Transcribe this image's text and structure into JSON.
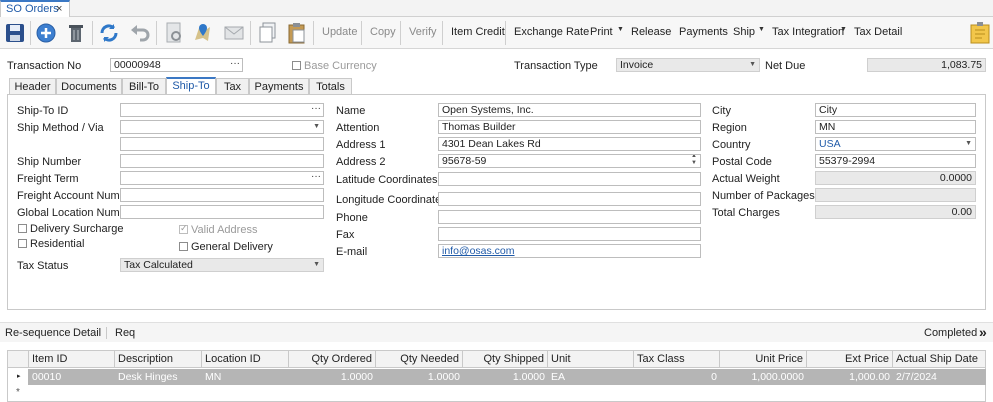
{
  "document_tab": {
    "title": "SO Orders",
    "close": "×"
  },
  "toolbar": {
    "update": "Update",
    "copy": "Copy",
    "verify": "Verify",
    "item_credit": "Item Credit",
    "exchange_rate": "Exchange Rate",
    "print": "Print",
    "release": "Release",
    "payments": "Payments",
    "ship": "Ship",
    "tax_integration": "Tax Integration",
    "tax_detail": "Tax Detail"
  },
  "header": {
    "transaction_no_label": "Transaction No",
    "transaction_no": "00000948",
    "base_currency_label": "Base Currency",
    "transaction_type_label": "Transaction Type",
    "transaction_type": "Invoice",
    "net_due_label": "Net Due",
    "net_due": "1,083.75"
  },
  "tabs": [
    "Header",
    "Documents",
    "Bill-To",
    "Ship-To",
    "Tax",
    "Payments",
    "Totals"
  ],
  "ship_to": {
    "ship_to_id_label": "Ship-To ID",
    "ship_to_id": "",
    "ship_method_label": "Ship Method / Via",
    "ship_method": "",
    "ship_number_label": "Ship Number",
    "freight_term_label": "Freight Term",
    "freight_account_label": "Freight Account Number",
    "global_location_label": "Global Location Number",
    "delivery_surcharge_label": "Delivery Surcharge",
    "valid_address_label": "Valid Address",
    "residential_label": "Residential",
    "general_delivery_label": "General Delivery",
    "tax_status_label": "Tax Status",
    "tax_status": "Tax Calculated",
    "name_label": "Name",
    "name": "Open Systems, Inc.",
    "attention_label": "Attention",
    "attention": "Thomas Builder",
    "address1_label": "Address 1",
    "address1": "4301 Dean Lakes Rd",
    "address2_label": "Address 2",
    "address2": "95678-59",
    "latitude_label": "Latitude Coordinates",
    "longitude_label": "Longitude Coordinates",
    "phone_label": "Phone",
    "fax_label": "Fax",
    "email_label": "E-mail",
    "email": "info@osas.com",
    "city_label": "City",
    "city": "City",
    "region_label": "Region",
    "region": "MN",
    "country_label": "Country",
    "country": "USA",
    "postal_label": "Postal Code",
    "postal": "55379-2994",
    "actual_weight_label": "Actual Weight",
    "actual_weight": "0.0000",
    "packages_label": "Number of Packages",
    "packages": "",
    "total_charges_label": "Total Charges",
    "total_charges": "0.00"
  },
  "detail_bar": {
    "resequence": "Re-sequence",
    "detail": "Detail",
    "req": "Req",
    "status": "Completed",
    "more": "»"
  },
  "grid": {
    "columns": [
      "Item ID",
      "Description",
      "Location ID",
      "Qty Ordered",
      "Qty Needed",
      "Qty Shipped",
      "Unit",
      "Tax Class",
      "Unit Price",
      "Ext Price",
      "Actual Ship Date"
    ],
    "rows": [
      {
        "item_id": "00010",
        "description": "Desk Hinges",
        "location_id": "MN",
        "qty_ordered": "1.0000",
        "qty_needed": "1.0000",
        "qty_shipped": "1.0000",
        "unit": "EA",
        "tax_class": "0",
        "unit_price": "1,000.0000",
        "ext_price": "1,000.00",
        "ship_date": "2/7/2024"
      }
    ],
    "new_row_marker": "*",
    "row_marker": "▸"
  }
}
